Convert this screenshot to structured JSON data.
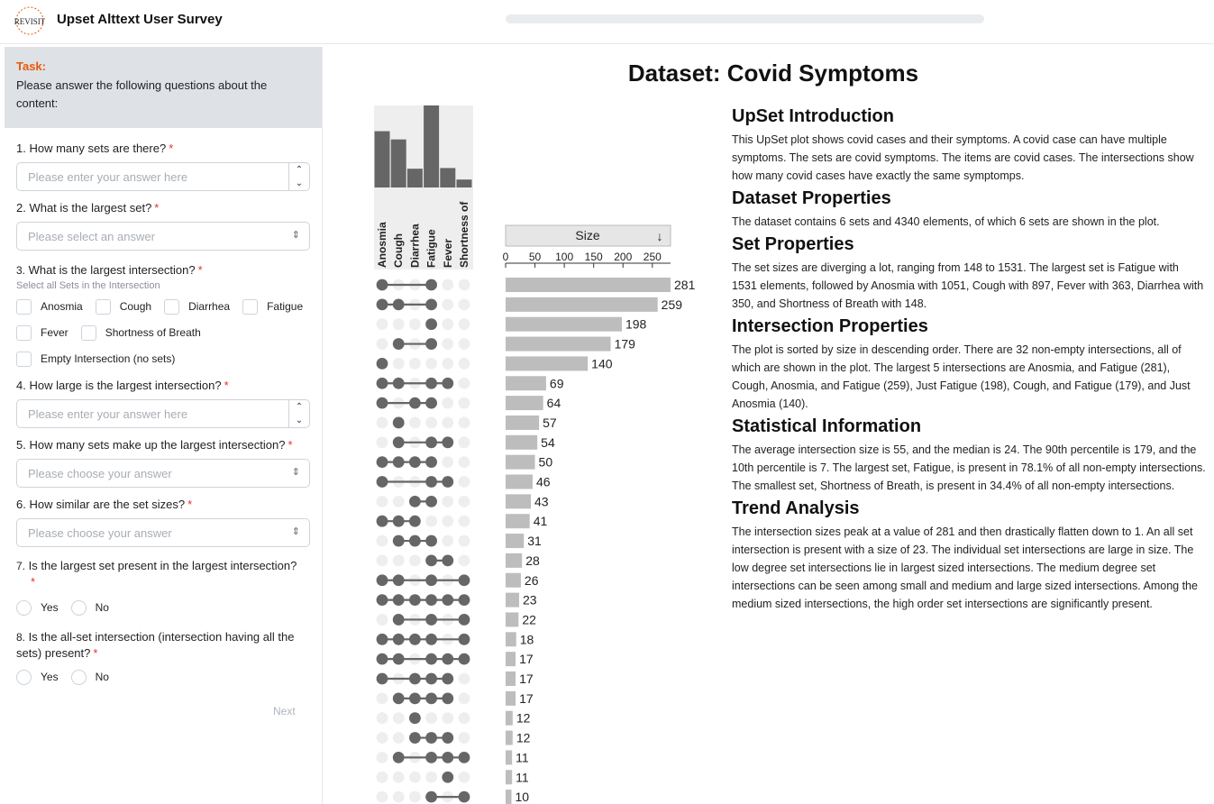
{
  "header": {
    "logo_text": "REVISIT",
    "title": "Upset Alttext User Survey",
    "progress": 0.0
  },
  "sidebar": {
    "task_label": "Task:",
    "task_text": "Please answer the following questions about the content:",
    "q1": {
      "title": "1. How many sets are there?",
      "placeholder": "Please enter your answer here"
    },
    "q2": {
      "title": "2. What is the largest set?",
      "placeholder": "Please select an answer"
    },
    "q3": {
      "num": "3.",
      "title": "What is the largest intersection?",
      "sub": "Select all Sets in the Intersection",
      "options": [
        "Anosmia",
        "Cough",
        "Diarrhea",
        "Fatigue",
        "Fever",
        "Shortness of Breath",
        "Empty Intersection (no sets)"
      ]
    },
    "q4": {
      "title": "4. How large is the largest intersection?",
      "placeholder": "Please enter your answer here"
    },
    "q5": {
      "title": "5. How many sets make up the largest intersection?",
      "placeholder": "Please choose your answer"
    },
    "q6": {
      "title": "6. How similar are the set sizes?",
      "placeholder": "Please choose your answer"
    },
    "q7": {
      "num": "7.",
      "title": "Is the largest set present in the largest intersection?",
      "yes": "Yes",
      "no": "No"
    },
    "q8": {
      "num": "8.",
      "title": "Is the all-set intersection (intersection having all the sets) present?",
      "yes": "Yes",
      "no": "No"
    },
    "required_mark": "*",
    "next_label": "Next"
  },
  "main": {
    "dataset_title": "Dataset: Covid Symptoms",
    "sections": [
      {
        "heading": "UpSet Introduction",
        "text": "This UpSet plot shows covid cases and their symptoms. A covid case can have multiple symptoms. The sets are covid symptoms. The items are covid cases. The intersections show how many covid cases have exactly the same symptomps."
      },
      {
        "heading": "Dataset Properties",
        "text": "The dataset contains 6 sets and 4340 elements, of which 6 sets are shown in the plot."
      },
      {
        "heading": "Set Properties",
        "text": "The set sizes are diverging a lot, ranging from 148 to 1531. The largest set is Fatigue with 1531 elements, followed by Anosmia with 1051, Cough with 897, Fever with 363, Diarrhea with 350, and Shortness of Breath with 148."
      },
      {
        "heading": "Intersection Properties",
        "text": "The plot is sorted by size in descending order. There are 32 non-empty intersections, all of which are shown in the plot. The largest 5 intersections are Anosmia, and Fatigue (281), Cough, Anosmia, and Fatigue (259), Just Fatigue (198), Cough, and Fatigue (179), and Just Anosmia (140)."
      },
      {
        "heading": "Statistical Information",
        "text": "The average intersection size is 55, and the median is 24. The 90th percentile is 179, and the 10th percentile is 7. The largest set, Fatigue, is present in 78.1% of all non-empty intersections. The smallest set, Shortness of Breath, is present in 34.4% of all non-empty intersections."
      },
      {
        "heading": "Trend Analysis",
        "text": "The intersection sizes peak at a value of 281 and then drastically flatten down to 1. An all set intersection is present with a size of 23. The individual set intersections are large in size. The low degree set intersections lie in largest sized intersections. The medium degree set intersections can be seen among small and medium and large sized intersections. Among the medium sized intersections, the high order set intersections are significantly present."
      }
    ]
  },
  "chart_data": {
    "type": "upset",
    "sets": [
      "Anosmia",
      "Cough",
      "Diarrhea",
      "Fatigue",
      "Fever",
      "Shortness of"
    ],
    "set_sizes": [
      1051,
      897,
      350,
      1531,
      363,
      148
    ],
    "size_header": "Size",
    "sort_icon": "arrow-down",
    "x_ticks": [
      0,
      50,
      100,
      150,
      200,
      250
    ],
    "xlim": [
      0,
      281
    ],
    "intersections": [
      {
        "members": [
          0,
          3
        ],
        "size": 281
      },
      {
        "members": [
          0,
          1,
          3
        ],
        "size": 259
      },
      {
        "members": [
          3
        ],
        "size": 198
      },
      {
        "members": [
          1,
          3
        ],
        "size": 179
      },
      {
        "members": [
          0
        ],
        "size": 140
      },
      {
        "members": [
          0,
          1,
          3,
          4
        ],
        "size": 69
      },
      {
        "members": [
          0,
          2,
          3
        ],
        "size": 64
      },
      {
        "members": [
          1
        ],
        "size": 57
      },
      {
        "members": [
          1,
          3,
          4
        ],
        "size": 54
      },
      {
        "members": [
          0,
          1,
          2,
          3
        ],
        "size": 50
      },
      {
        "members": [
          0,
          3,
          4
        ],
        "size": 46
      },
      {
        "members": [
          2,
          3
        ],
        "size": 43
      },
      {
        "members": [
          0,
          1,
          2
        ],
        "size": 41
      },
      {
        "members": [
          1,
          2,
          3
        ],
        "size": 31
      },
      {
        "members": [
          3,
          4
        ],
        "size": 28
      },
      {
        "members": [
          0,
          1,
          3,
          5
        ],
        "size": 26
      },
      {
        "members": [
          0,
          1,
          2,
          3,
          4,
          5
        ],
        "size": 23
      },
      {
        "members": [
          1,
          3,
          5
        ],
        "size": 22
      },
      {
        "members": [
          0,
          1,
          2,
          3,
          5
        ],
        "size": 18
      },
      {
        "members": [
          0,
          1,
          3,
          4,
          5
        ],
        "size": 17
      },
      {
        "members": [
          0,
          2,
          3,
          4
        ],
        "size": 17
      },
      {
        "members": [
          1,
          2,
          3,
          4
        ],
        "size": 17
      },
      {
        "members": [
          2
        ],
        "size": 12
      },
      {
        "members": [
          2,
          3,
          4
        ],
        "size": 12
      },
      {
        "members": [
          1,
          3,
          4,
          5
        ],
        "size": 11
      },
      {
        "members": [
          4
        ],
        "size": 11
      },
      {
        "members": [
          3,
          5
        ],
        "size": 10
      }
    ]
  }
}
